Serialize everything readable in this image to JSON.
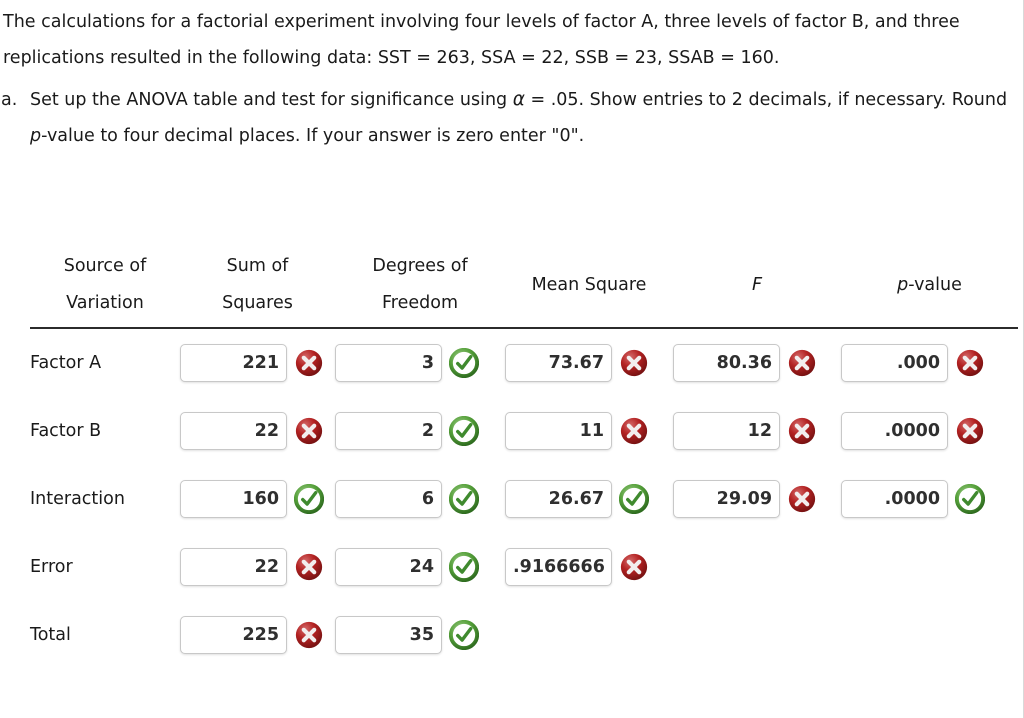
{
  "prompt": {
    "intro_part1": "The calculations for a factorial experiment involving four levels of factor A, three levels of factor B, and three replications resulted in the following data: SST = 263, SSA = 22, SSB = 23, SSAB = 160.",
    "question_marker": "a.",
    "question_part1": "Set up the ANOVA table and test for significance using ",
    "alpha_symbol": "α",
    "question_part2": " = .05. Show entries to 2 decimals, if necessary. Round ",
    "italic_p": "p",
    "question_part3": "-value to four decimal places. If your answer is zero enter \"0\"."
  },
  "table": {
    "headers": [
      {
        "line1": "Source of",
        "line2": "Variation",
        "italic": false
      },
      {
        "line1": "Sum of",
        "line2": "Squares",
        "italic": false
      },
      {
        "line1": "Degrees of",
        "line2": "Freedom",
        "italic": false
      },
      {
        "line1": "Mean Square",
        "line2": "",
        "italic": false
      },
      {
        "line1": "F",
        "line2": "",
        "italic": true
      },
      {
        "line1": "p-value",
        "line2": "",
        "italic": false
      }
    ],
    "rows": [
      {
        "label": "Factor A",
        "cells": [
          {
            "value": "221",
            "status": "incorrect"
          },
          {
            "value": "3",
            "status": "correct"
          },
          {
            "value": "73.67",
            "status": "incorrect"
          },
          {
            "value": "80.36",
            "status": "incorrect"
          },
          {
            "value": ".000",
            "status": "incorrect"
          }
        ]
      },
      {
        "label": "Factor B",
        "cells": [
          {
            "value": "22",
            "status": "incorrect"
          },
          {
            "value": "2",
            "status": "correct"
          },
          {
            "value": "11",
            "status": "incorrect"
          },
          {
            "value": "12",
            "status": "incorrect"
          },
          {
            "value": ".0000",
            "status": "incorrect"
          }
        ]
      },
      {
        "label": "Interaction",
        "cells": [
          {
            "value": "160",
            "status": "correct"
          },
          {
            "value": "6",
            "status": "correct"
          },
          {
            "value": "26.67",
            "status": "correct"
          },
          {
            "value": "29.09",
            "status": "incorrect"
          },
          {
            "value": ".0000",
            "status": "correct"
          }
        ]
      },
      {
        "label": "Error",
        "cells": [
          {
            "value": "22",
            "status": "incorrect"
          },
          {
            "value": "24",
            "status": "correct"
          },
          {
            "value": ".9166666",
            "status": "incorrect"
          },
          {
            "value": null,
            "status": "none"
          },
          {
            "value": null,
            "status": "none"
          }
        ]
      },
      {
        "label": "Total",
        "cells": [
          {
            "value": "225",
            "status": "incorrect"
          },
          {
            "value": "35",
            "status": "correct"
          },
          {
            "value": null,
            "status": "none"
          },
          {
            "value": null,
            "status": "none"
          },
          {
            "value": null,
            "status": "none"
          }
        ]
      }
    ]
  },
  "icons": {
    "correct_name": "green-check-circle-icon",
    "incorrect_name": "red-x-circle-icon",
    "correct_color": "#3f8a2e",
    "incorrect_color": "#a81f1f"
  }
}
